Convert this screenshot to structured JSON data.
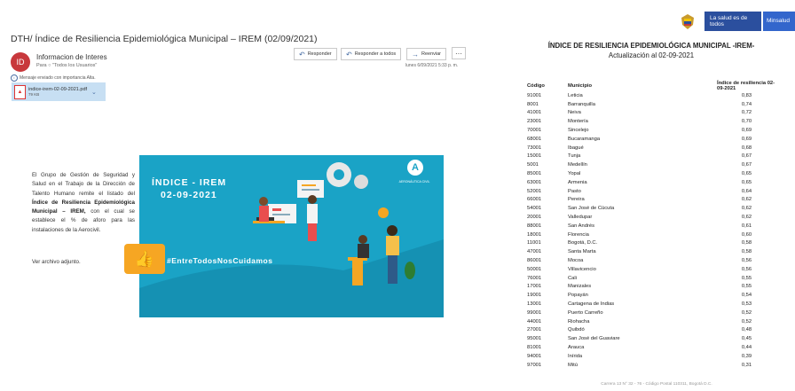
{
  "email": {
    "subject": "DTH/  Índice de Resiliencia Epidemiológica Municipal – IREM (02/09/2021)",
    "avatar_initials": "ID",
    "avatar_color": "#c8383c",
    "sender": "Informacion de Interes",
    "to_label": "Para",
    "recipients": "\"Todos los Usuarios\"",
    "timestamp": "lunes 6/09/2021 5:33 p. m.",
    "importance": "Mensaje enviado con importancia Alta.",
    "buttons": {
      "reply": "Responder",
      "reply_all": "Responder a todos",
      "forward": "Reenviar",
      "more": "···"
    },
    "attachment": {
      "name": "indice-irem-02-09-2021.pdf",
      "size": "79 KB"
    },
    "body": {
      "p1": "El Grupo de Gestión de Seguridad y Salud en el Trabajo de la Dirección de Talento Humano remite el listado del ",
      "bold1": "Índice de Resiliencia Epidemiológica Municipal – IREM,",
      "p2": " con el cual se establece el % de aforo para las instalaciones de la Aerocivil.",
      "closing": "Ver archivo adjunto."
    },
    "banner": {
      "title": "ÍNDICE - IREM",
      "date": "02-09-2021",
      "hashtag": "#EntreTodosNosCuidamos",
      "org": "AERONÁUTICA CIVIL",
      "color": "#1aa3c6"
    }
  },
  "document": {
    "header_logo": "La salud es de todos",
    "header_ministry": "Minsalud",
    "title": "ÍNDICE DE RESILIENCIA EPIDEMIOLÓGICA MUNICIPAL -IREM-",
    "subtitle": "Actualización al 02-09-2021",
    "columns": [
      "Código",
      "Municipio",
      "Índice de resiliencia 02-09-2021"
    ],
    "rows": [
      [
        "91001",
        "Leticia",
        "0,83"
      ],
      [
        "8001",
        "Barranquilla",
        "0,74"
      ],
      [
        "41001",
        "Neiva",
        "0,72"
      ],
      [
        "23001",
        "Montería",
        "0,70"
      ],
      [
        "70001",
        "Sincelejo",
        "0,69"
      ],
      [
        "68001",
        "Bucaramanga",
        "0,69"
      ],
      [
        "73001",
        "Ibagué",
        "0,68"
      ],
      [
        "15001",
        "Tunja",
        "0,67"
      ],
      [
        "5001",
        "Medellín",
        "0,67"
      ],
      [
        "85001",
        "Yopal",
        "0,65"
      ],
      [
        "63001",
        "Armenia",
        "0,65"
      ],
      [
        "52001",
        "Pasto",
        "0,64"
      ],
      [
        "66001",
        "Pereira",
        "0,62"
      ],
      [
        "54001",
        "San José de Cúcuta",
        "0,62"
      ],
      [
        "20001",
        "Valledupar",
        "0,62"
      ],
      [
        "88001",
        "San Andrés",
        "0,61"
      ],
      [
        "18001",
        "Florencia",
        "0,60"
      ],
      [
        "11001",
        "Bogotá, D.C.",
        "0,58"
      ],
      [
        "47001",
        "Santa Marta",
        "0,58"
      ],
      [
        "86001",
        "Mocoa",
        "0,56"
      ],
      [
        "50001",
        "Villavicencio",
        "0,56"
      ],
      [
        "76001",
        "Cali",
        "0,55"
      ],
      [
        "17001",
        "Manizales",
        "0,55"
      ],
      [
        "19001",
        "Popayán",
        "0,54"
      ],
      [
        "13001",
        "Cartagena de Indias",
        "0,53"
      ],
      [
        "99001",
        "Puerto Carreño",
        "0,52"
      ],
      [
        "44001",
        "Riohacha",
        "0,52"
      ],
      [
        "27001",
        "Quibdó",
        "0,48"
      ],
      [
        "95001",
        "San José del Guaviare",
        "0,45"
      ],
      [
        "81001",
        "Arauca",
        "0,44"
      ],
      [
        "94001",
        "Inírida",
        "0,39"
      ],
      [
        "97001",
        "Mitú",
        "0,31"
      ]
    ],
    "footer": "Carrera 13 N° 32 - 76 - Código Postal 110311, Bogotá D.C."
  }
}
